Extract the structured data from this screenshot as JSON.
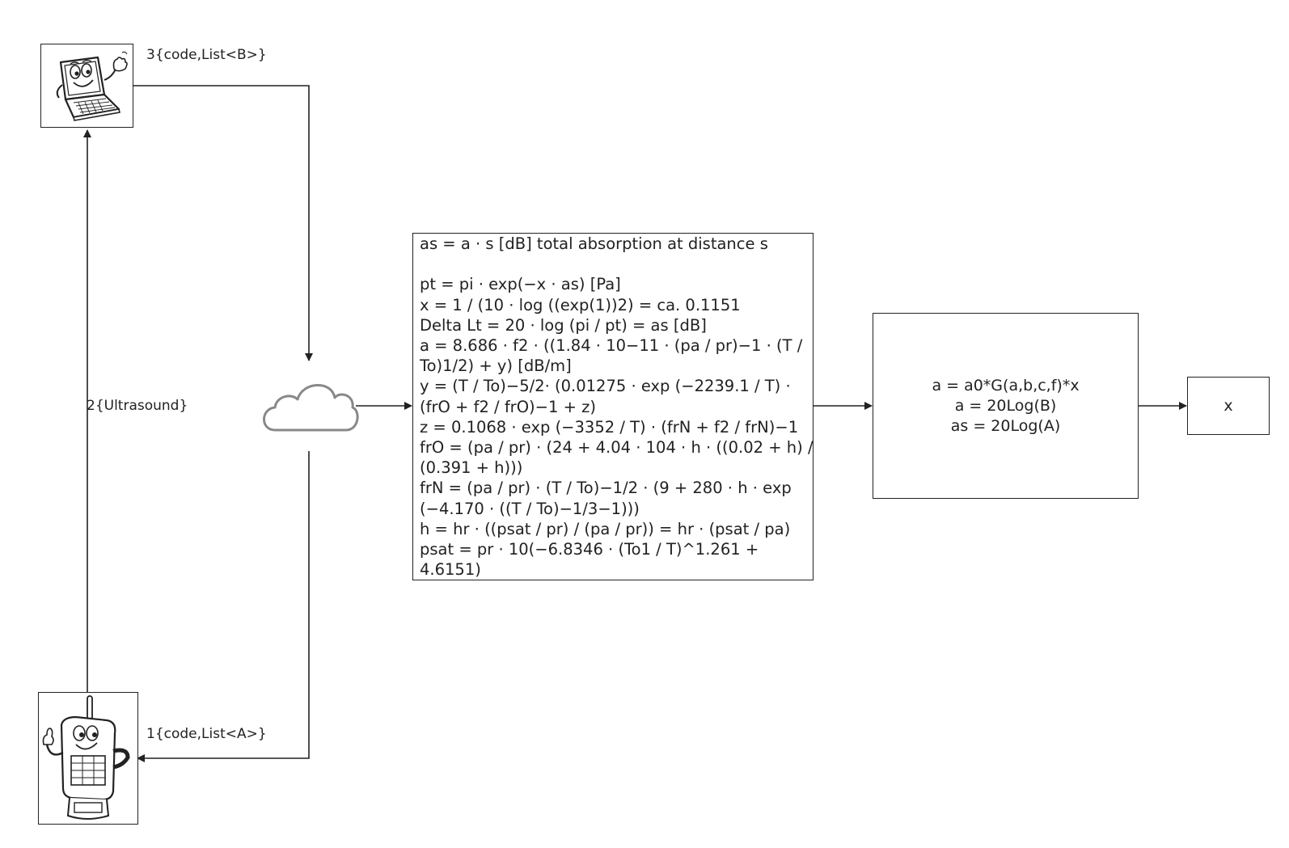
{
  "edges": {
    "laptop_label": "3{code,List<B>}",
    "ultrasound_label": "2{Ultrasound}",
    "phone_label": "1{code,List<A>}"
  },
  "formula_box": {
    "lines": [
      "as = a · s [dB] total absorption at distance s",
      "",
      "pt = pi · exp(−x · as) [Pa]",
      "x = 1 / (10 · log ((exp(1))2) = ca. 0.1151",
      "Delta Lt = 20 · log (pi / pt) = as [dB]",
      "a = 8.686 · f2 · ((1.84 · 10−11 · (pa / pr)−1 · (T /",
      "To)1/2) + y) [dB/m]",
      "y = (T / To)−5/2· (0.01275 · exp (−2239.1 / T) ·",
      "(frO + f2 / frO)−1 + z)",
      "z = 0.1068 · exp (−3352 / T) · (frN + f2 / frN)−1",
      "frO = (pa / pr) · (24 + 4.04 · 104 · h · ((0.02 + h) /",
      "(0.391 + h)))",
      "frN = (pa / pr) · (T / To)−1/2 · (9 + 280 · h · exp",
      "(−4.170 · ((T / To)−1/3−1)))",
      "h = hr · ((psat / pr) / (pa / pr)) = hr · (psat / pa)",
      "psat = pr · 10(−6.8346 · (To1 / T)^1.261 +",
      "4.6151)"
    ]
  },
  "calc_box": {
    "line1": "a = a0*G(a,b,c,f)*x",
    "line2": "a = 20Log(B)",
    "line3": "as = 20Log(A)"
  },
  "output_box": {
    "label": "x"
  },
  "icons": {
    "laptop": "laptop-character-icon",
    "phone": "phone-character-icon",
    "cloud": "cloud-icon"
  }
}
